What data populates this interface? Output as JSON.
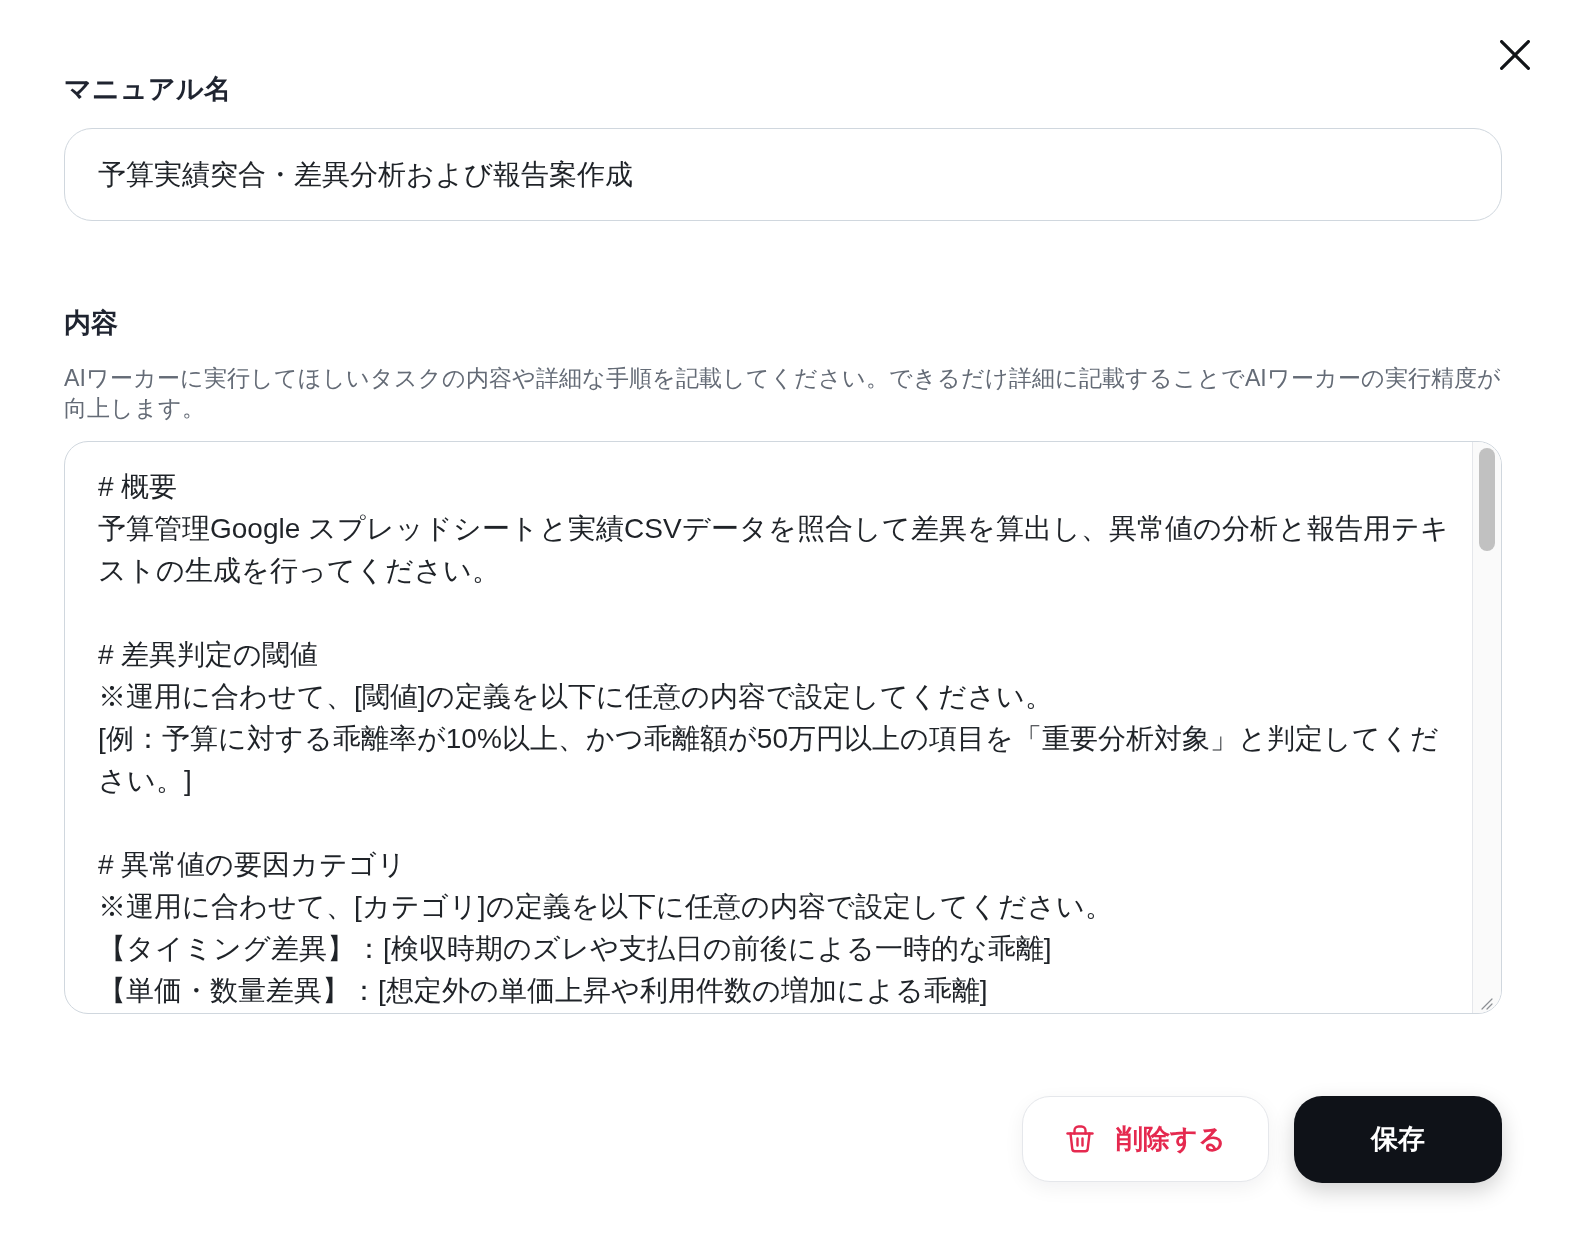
{
  "fields": [
    {
      "kind": "input",
      "label": "マニュアル名",
      "value": "予算実績突合・差異分析および報告案作成"
    },
    {
      "kind": "textarea",
      "label": "内容",
      "description": "AIワーカーに実行してほしいタスクの内容や詳細な手順を記載してください。できるだけ詳細に記載することでAIワーカーの実行精度が向上します。",
      "paragraphs": [
        {
          "lines": [
            "# 概要",
            "予算管理Google スプレッドシートと実績CSVデータを照合して差異を算出し、異常値の分析と報告用テキストの生成を行ってください。"
          ]
        },
        {
          "lines": [
            "# 差異判定の閾値",
            "※運用に合わせて、[閾値]の定義を以下に任意の内容で設定してください。",
            "[例：予算に対する乖離率が10%以上、かつ乖離額が50万円以上の項目を「重要分析対象」と判定してください。]"
          ]
        },
        {
          "lines": [
            "# 異常値の要因カテゴリ",
            "※運用に合わせて、[カテゴリ]の定義を以下に任意の内容で設定してください。",
            "【タイミング差異】：[検収時期のズレや支払日の前後による一時的な乖離]",
            "【単価・数量差異】：[想定外の単価上昇や利用件数の増加による乖離]"
          ]
        }
      ]
    }
  ],
  "actions": [
    {
      "kind": "danger",
      "label": "削除する"
    },
    {
      "kind": "primary",
      "label": "保存"
    }
  ]
}
